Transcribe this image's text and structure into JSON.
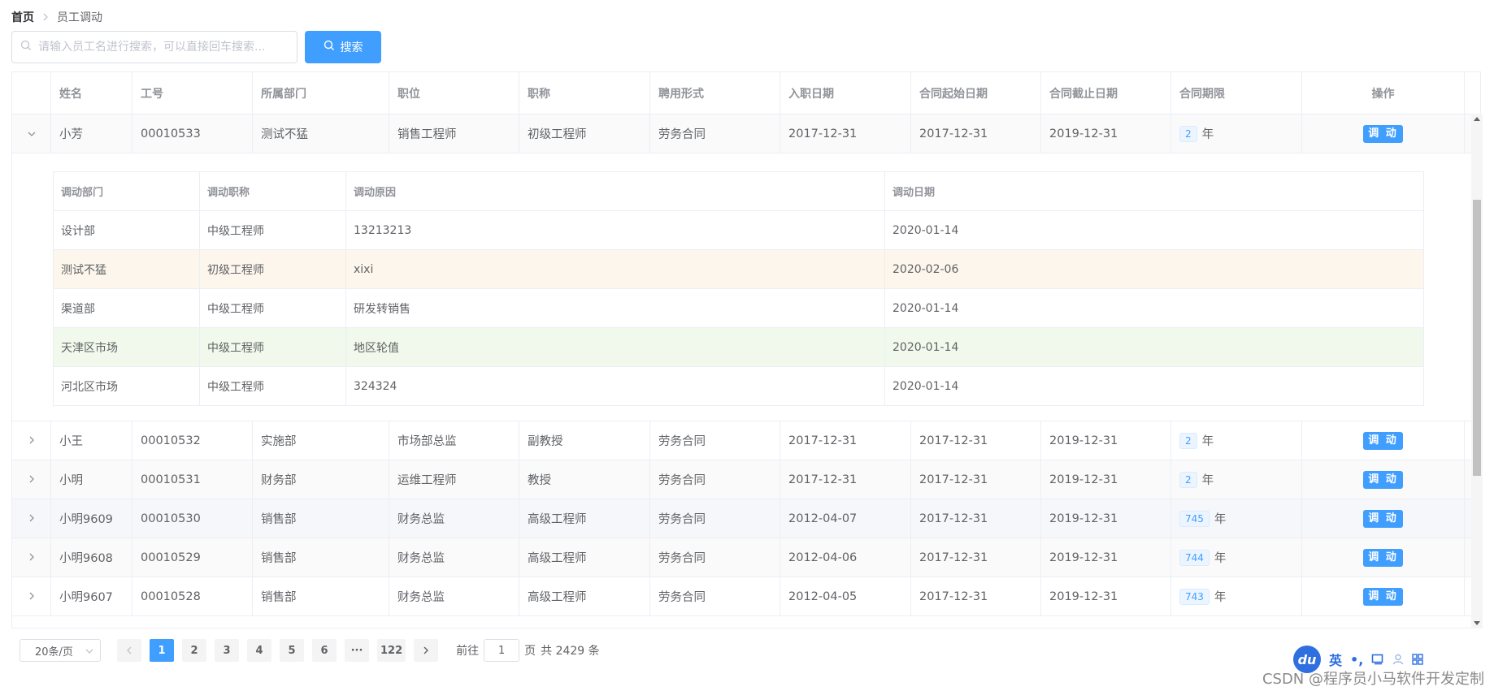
{
  "breadcrumb": {
    "home": "首页",
    "current": "员工调动"
  },
  "search": {
    "placeholder": "请输入员工名进行搜索，可以直接回车搜索...",
    "button_label": "搜索"
  },
  "table": {
    "columns": [
      "",
      "姓名",
      "工号",
      "所属部门",
      "职位",
      "职称",
      "聘用形式",
      "入职日期",
      "合同起始日期",
      "合同截止日期",
      "合同期限",
      "操作"
    ],
    "action_label": "调 动",
    "year_unit": "年",
    "rows": [
      {
        "name": "小芳",
        "id": "00010533",
        "dept": "测试不猛",
        "position": "销售工程师",
        "title": "初级工程师",
        "employment": "劳务合同",
        "join_date": "2017-12-31",
        "contract_start": "2017-12-31",
        "contract_end": "2019-12-31",
        "term": "2"
      },
      {
        "name": "小王",
        "id": "00010532",
        "dept": "实施部",
        "position": "市场部总监",
        "title": "副教授",
        "employment": "劳务合同",
        "join_date": "2017-12-31",
        "contract_start": "2017-12-31",
        "contract_end": "2019-12-31",
        "term": "2"
      },
      {
        "name": "小明",
        "id": "00010531",
        "dept": "财务部",
        "position": "运维工程师",
        "title": "教授",
        "employment": "劳务合同",
        "join_date": "2017-12-31",
        "contract_start": "2017-12-31",
        "contract_end": "2019-12-31",
        "term": "2"
      },
      {
        "name": "小明9609",
        "id": "00010530",
        "dept": "销售部",
        "position": "财务总监",
        "title": "高级工程师",
        "employment": "劳务合同",
        "join_date": "2012-04-07",
        "contract_start": "2017-12-31",
        "contract_end": "2019-12-31",
        "term": "745"
      },
      {
        "name": "小明9608",
        "id": "00010529",
        "dept": "销售部",
        "position": "财务总监",
        "title": "高级工程师",
        "employment": "劳务合同",
        "join_date": "2012-04-06",
        "contract_start": "2017-12-31",
        "contract_end": "2019-12-31",
        "term": "744"
      },
      {
        "name": "小明9607",
        "id": "00010528",
        "dept": "销售部",
        "position": "财务总监",
        "title": "高级工程师",
        "employment": "劳务合同",
        "join_date": "2012-04-05",
        "contract_start": "2017-12-31",
        "contract_end": "2019-12-31",
        "term": "743"
      }
    ]
  },
  "detail": {
    "columns": [
      "调动部门",
      "调动职称",
      "调动原因",
      "调动日期"
    ],
    "rows": [
      {
        "dept": "设计部",
        "title": "中级工程师",
        "reason": "13213213",
        "date": "2020-01-14",
        "status": "normal"
      },
      {
        "dept": "测试不猛",
        "title": "初级工程师",
        "reason": "xixi",
        "date": "2020-02-06",
        "status": "warning"
      },
      {
        "dept": "渠道部",
        "title": "中级工程师",
        "reason": "研发转销售",
        "date": "2020-01-14",
        "status": "normal"
      },
      {
        "dept": "天津区市场",
        "title": "中级工程师",
        "reason": "地区轮值",
        "date": "2020-01-14",
        "status": "success"
      },
      {
        "dept": "河北区市场",
        "title": "中级工程师",
        "reason": "324324",
        "date": "2020-01-14",
        "status": "normal"
      }
    ]
  },
  "pagination": {
    "page_size": "20条/页",
    "pages": [
      "1",
      "2",
      "3",
      "4",
      "5",
      "6"
    ],
    "ellipsis": "···",
    "last_page": "122",
    "current_page": "1",
    "goto_prefix": "前往",
    "goto_value": "1",
    "goto_suffix": "页",
    "total_text": "共 2429 条"
  },
  "ime": {
    "logo": "du",
    "lang": "英",
    "punct": "•,",
    "colors": {
      "brand": "#2f6fe0"
    }
  },
  "watermark": "CSDN @程序员小马软件开发定制",
  "colors": {
    "primary": "#409eff",
    "warning_row": "#fdf6ec",
    "success_row": "#f0f9eb"
  }
}
